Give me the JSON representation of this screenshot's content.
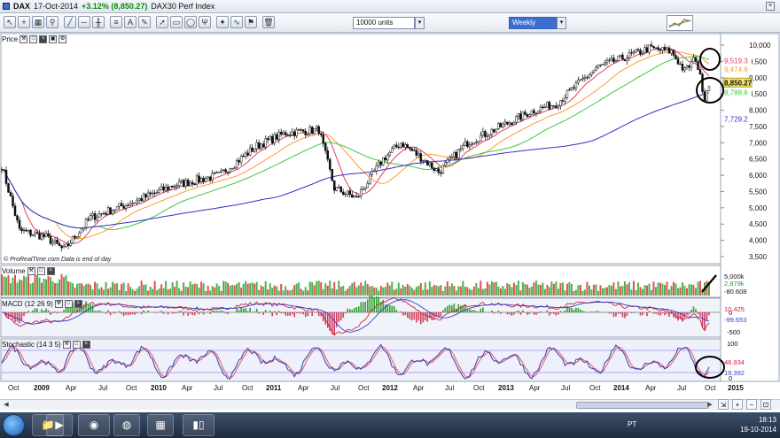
{
  "window": {
    "symbol": "DAX",
    "date": "17-Oct-2014",
    "change": "+3.12% (8,850.27)",
    "instrument": "DAX30 Perf Index"
  },
  "toolbar": {
    "units_value": "10000 units",
    "period_value": "Weekly",
    "icons": [
      "cursor-icon",
      "crosshair-icon",
      "zoom-icon",
      "search-icon",
      "trendline-icon",
      "horizontal-line-icon",
      "channel-icon",
      "fibonacci-icon",
      "text-icon",
      "pencil-icon",
      "arrow-icon",
      "rectangle-icon",
      "ellipse-icon",
      "pitchfork-icon",
      "gann-icon",
      "cycle-icon",
      "alert-icon",
      "tools-icon",
      "ruler-icon",
      "trash-icon"
    ]
  },
  "price_panel": {
    "title": "Price",
    "watermark": "© ProRealTime.com  Data is end of day",
    "y_ticks": [
      "10,000",
      "9,500",
      "9,000",
      "8,500",
      "8,000",
      "7,500",
      "7,000",
      "6,500",
      "6,000",
      "5,500",
      "5,000",
      "4,500",
      "4,000",
      "3,500"
    ],
    "labels": {
      "ma_short": "9,519.3",
      "ma_mid": "9,474.8",
      "last": "8,850.27",
      "ma_long": "8,788.6",
      "ma_200": "7,729.2"
    },
    "colors": {
      "ma_short": "#e04060",
      "ma_mid": "#ff9a2e",
      "ma_long": "#3ec83e",
      "ma_200": "#3030c8",
      "last": "#f5e56a"
    }
  },
  "volume_panel": {
    "title": "Volume",
    "y_ticks": [
      "5,000k",
      "0"
    ],
    "labels": {
      "a": "2,879k",
      "b": "-80.608"
    }
  },
  "macd_panel": {
    "title": "MACD (12 26 9)",
    "y_ticks": [
      "0",
      "-500"
    ],
    "labels": {
      "a": "10.425",
      "b": "-99.653"
    }
  },
  "stoch_panel": {
    "title": "Stochastic (14 3 5)",
    "y_ticks": [
      "100",
      "0"
    ],
    "labels": {
      "a": "46.934",
      "b": "19.392"
    }
  },
  "x_axis": [
    {
      "label": "Oct",
      "year": false
    },
    {
      "label": "2009",
      "year": true
    },
    {
      "label": "Apr",
      "year": false
    },
    {
      "label": "Jul",
      "year": false
    },
    {
      "label": "Oct",
      "year": false
    },
    {
      "label": "2010",
      "year": true
    },
    {
      "label": "Apr",
      "year": false
    },
    {
      "label": "Jul",
      "year": false
    },
    {
      "label": "Oct",
      "year": false
    },
    {
      "label": "2011",
      "year": true
    },
    {
      "label": "Apr",
      "year": false
    },
    {
      "label": "Jul",
      "year": false
    },
    {
      "label": "Oct",
      "year": false
    },
    {
      "label": "2012",
      "year": true
    },
    {
      "label": "Apr",
      "year": false
    },
    {
      "label": "Jul",
      "year": false
    },
    {
      "label": "Oct",
      "year": false
    },
    {
      "label": "2013",
      "year": true
    },
    {
      "label": "Apr",
      "year": false
    },
    {
      "label": "Jul",
      "year": false
    },
    {
      "label": "Oct",
      "year": false
    },
    {
      "label": "2014",
      "year": true
    },
    {
      "label": "Apr",
      "year": false
    },
    {
      "label": "Jul",
      "year": false
    },
    {
      "label": "Oct",
      "year": false
    },
    {
      "label": "2015",
      "year": true
    }
  ],
  "taskbar": {
    "language": "PT",
    "time": "18:13",
    "date": "19-10-2014"
  }
}
